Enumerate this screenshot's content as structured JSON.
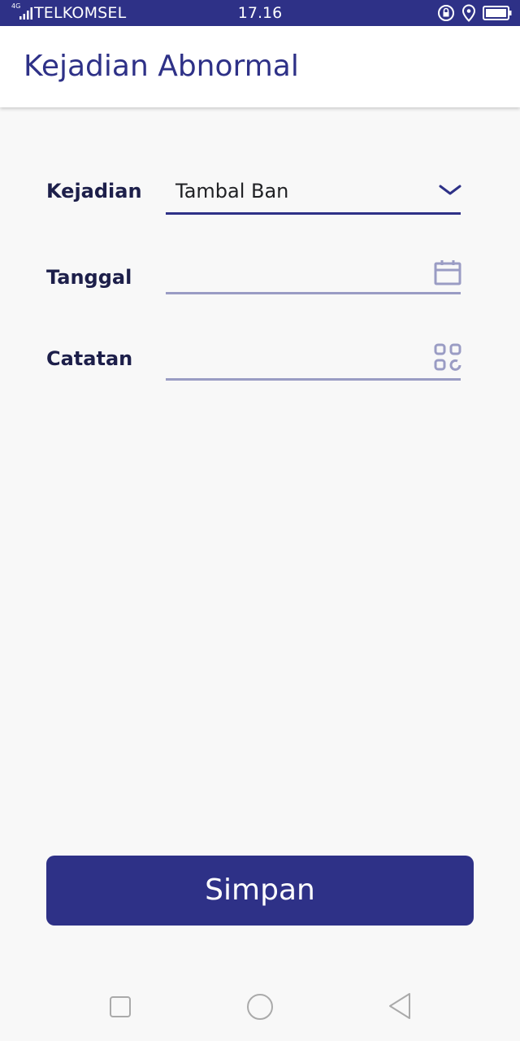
{
  "status_bar": {
    "network": "4G",
    "carrier": "TELKOMSEL",
    "time": "17.16",
    "icons": [
      "signal-icon",
      "rotation-lock-icon",
      "location-icon",
      "battery-icon"
    ]
  },
  "app_bar": {
    "title": "Kejadian Abnormal"
  },
  "form": {
    "kejadian": {
      "label": "Kejadian",
      "value": "Tambal Ban",
      "icon": "chevron-down-icon"
    },
    "tanggal": {
      "label": "Tanggal",
      "value": "",
      "icon": "calendar-icon"
    },
    "catatan": {
      "label": "Catatan",
      "value": "",
      "icon": "grid-icon"
    }
  },
  "actions": {
    "save_label": "Simpan"
  },
  "nav_bar": {
    "buttons": [
      "recents-icon",
      "home-icon",
      "back-icon"
    ]
  },
  "colors": {
    "primary": "#2e3187",
    "label": "#1d1f4a",
    "inactive_line": "#9a9cc4",
    "background": "#f8f8f8"
  }
}
